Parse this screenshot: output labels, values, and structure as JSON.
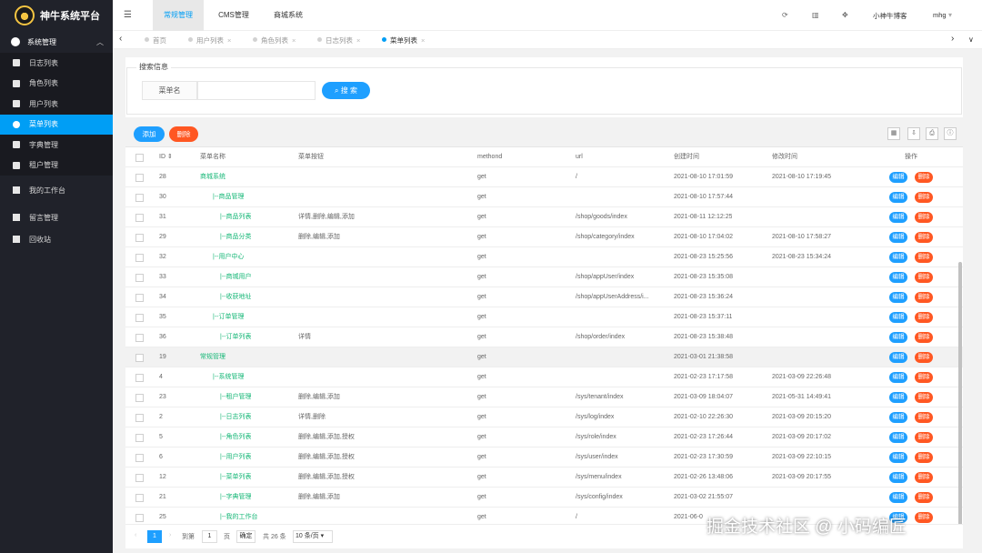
{
  "app": {
    "title": "神牛系统平台"
  },
  "sidebar": {
    "group1": "系统管理",
    "items": [
      "日志列表",
      "角色列表",
      "用户列表",
      "菜单列表",
      "字典管理",
      "租户管理"
    ],
    "group2": "我的工作台",
    "extra": [
      "留言管理",
      "回收站"
    ]
  },
  "topbar": {
    "tabs": [
      "常规管理",
      "CMS管理",
      "商城系统"
    ],
    "user": "小神牛博客",
    "account": "mhg"
  },
  "tabstrip": {
    "tabs": [
      "首页",
      "用户列表",
      "角色列表",
      "日志列表",
      "菜单列表"
    ]
  },
  "search": {
    "legend": "搜索信息",
    "label": "菜单名",
    "button": "搜 索"
  },
  "toolbar": {
    "add": "添加",
    "delete": "删除"
  },
  "table": {
    "columns": [
      "ID",
      "菜单名称",
      "菜单按钮",
      "methond",
      "url",
      "创建时间",
      "修改时间",
      "操作"
    ],
    "rows": [
      {
        "id": "28",
        "name": "商城系统",
        "buttons": "",
        "method": "get",
        "url": "/",
        "created": "2021-08-10 17:01:59",
        "updated": "2021-08-10 17:19:45"
      },
      {
        "id": "30",
        "name": "|--商品管理",
        "buttons": "",
        "method": "get",
        "url": "",
        "created": "2021-08-10 17:57:44",
        "updated": ""
      },
      {
        "id": "31",
        "name": "|--商品列表",
        "buttons": "详情,删除,编辑,添加",
        "method": "get",
        "url": "/shop/goods/index",
        "created": "2021-08-11 12:12:25",
        "updated": ""
      },
      {
        "id": "29",
        "name": "|--商品分类",
        "buttons": "删除,编辑,添加",
        "method": "get",
        "url": "/shop/category/index",
        "created": "2021-08-10 17:04:02",
        "updated": "2021-08-10 17:58:27"
      },
      {
        "id": "32",
        "name": "|--用户中心",
        "buttons": "",
        "method": "get",
        "url": "",
        "created": "2021-08-23 15:25:56",
        "updated": "2021-08-23 15:34:24"
      },
      {
        "id": "33",
        "name": "|--商城用户",
        "buttons": "",
        "method": "get",
        "url": "/shop/appUser/index",
        "created": "2021-08-23 15:35:08",
        "updated": ""
      },
      {
        "id": "34",
        "name": "|--收获地址",
        "buttons": "",
        "method": "get",
        "url": "/shop/appUserAddress/i...",
        "created": "2021-08-23 15:36:24",
        "updated": ""
      },
      {
        "id": "35",
        "name": "|--订单管理",
        "buttons": "",
        "method": "get",
        "url": "",
        "created": "2021-08-23 15:37:11",
        "updated": ""
      },
      {
        "id": "36",
        "name": "|--订单列表",
        "buttons": "详情",
        "method": "get",
        "url": "/shop/order/index",
        "created": "2021-08-23 15:38:48",
        "updated": ""
      },
      {
        "id": "19",
        "name": "常规管理",
        "buttons": "",
        "method": "get",
        "url": "",
        "created": "2021-03-01 21:38:58",
        "updated": ""
      },
      {
        "id": "4",
        "name": "|--系统管理",
        "buttons": "",
        "method": "get",
        "url": "",
        "created": "2021-02-23 17:17:58",
        "updated": "2021-03-09 22:26:48"
      },
      {
        "id": "23",
        "name": "|--租户管理",
        "buttons": "删除,编辑,添加",
        "method": "get",
        "url": "/sys/tenant/index",
        "created": "2021-03-09 18:04:07",
        "updated": "2021-05-31 14:49:41"
      },
      {
        "id": "2",
        "name": "|--日志列表",
        "buttons": "详情,删除",
        "method": "get",
        "url": "/sys/log/index",
        "created": "2021-02-10 22:26:30",
        "updated": "2021-03-09 20:15:20"
      },
      {
        "id": "5",
        "name": "|--角色列表",
        "buttons": "删除,编辑,添加,授权",
        "method": "get",
        "url": "/sys/role/index",
        "created": "2021-02-23 17:26:44",
        "updated": "2021-03-09 20:17:02"
      },
      {
        "id": "6",
        "name": "|--用户列表",
        "buttons": "删除,编辑,添加,授权",
        "method": "get",
        "url": "/sys/user/index",
        "created": "2021-02-23 17:30:59",
        "updated": "2021-03-09 22:10:15"
      },
      {
        "id": "12",
        "name": "|--菜单列表",
        "buttons": "删除,编辑,添加,授权",
        "method": "get",
        "url": "/sys/menu/index",
        "created": "2021-02-26 13:48:06",
        "updated": "2021-03-09 20:17:55"
      },
      {
        "id": "21",
        "name": "|--字典管理",
        "buttons": "删除,编辑,添加",
        "method": "get",
        "url": "/sys/config/index",
        "created": "2021-03-02 21:55:07",
        "updated": ""
      },
      {
        "id": "25",
        "name": "|--我的工作台",
        "buttons": "",
        "method": "get",
        "url": "/",
        "created": "2021-06-0",
        "updated": ""
      }
    ],
    "edit": "编辑",
    "del": "删除"
  },
  "pager": {
    "current": "1",
    "goto_label": "到第",
    "page_input": "1",
    "page_unit": "页",
    "confirm": "确定",
    "total": "共 26 条",
    "per_page": "10 条/页"
  },
  "watermark": "掘金技术社区 @ 小码编匠"
}
